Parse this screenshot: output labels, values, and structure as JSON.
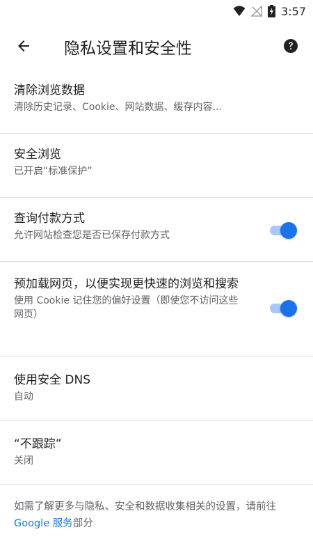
{
  "status_bar": {
    "time": "3:57",
    "icons": [
      "wifi-icon",
      "no-signal-icon",
      "battery-charging-icon"
    ]
  },
  "header": {
    "title": "隐私设置和安全性",
    "back_icon": "arrow-back-icon",
    "help_icon": "help-icon"
  },
  "settings": {
    "clear_data": {
      "title": "清除浏览数据",
      "subtitle": "清除历史记录、Cookie、网站数据、缓存内容..."
    },
    "safe_browsing": {
      "title": "安全浏览",
      "subtitle": "已开启“标准保护”"
    },
    "payment_methods": {
      "title": "查询付款方式",
      "subtitle": "允许网站检查您是否已保存付款方式",
      "enabled": true
    },
    "preload": {
      "title": "预加载网页，以便实现更快速的浏览和搜索",
      "subtitle": "使用 Cookie 记住您的偏好设置（即使您不访问这些网页）",
      "enabled": true
    },
    "secure_dns": {
      "title": "使用安全 DNS",
      "subtitle": "自动"
    },
    "do_not_track": {
      "title": "“不跟踪”",
      "subtitle": "关闭"
    }
  },
  "footer": {
    "text_before": "如需了解更多与隐私、安全和数据收集相关的设置，请前往 ",
    "link": "Google 服务",
    "text_after": "部分"
  },
  "colors": {
    "accent": "#1a73e8",
    "toggle_track": "#a9c7fa",
    "text_primary": "#202124",
    "text_secondary": "#5f6368",
    "divider": "#e0e0e0"
  }
}
